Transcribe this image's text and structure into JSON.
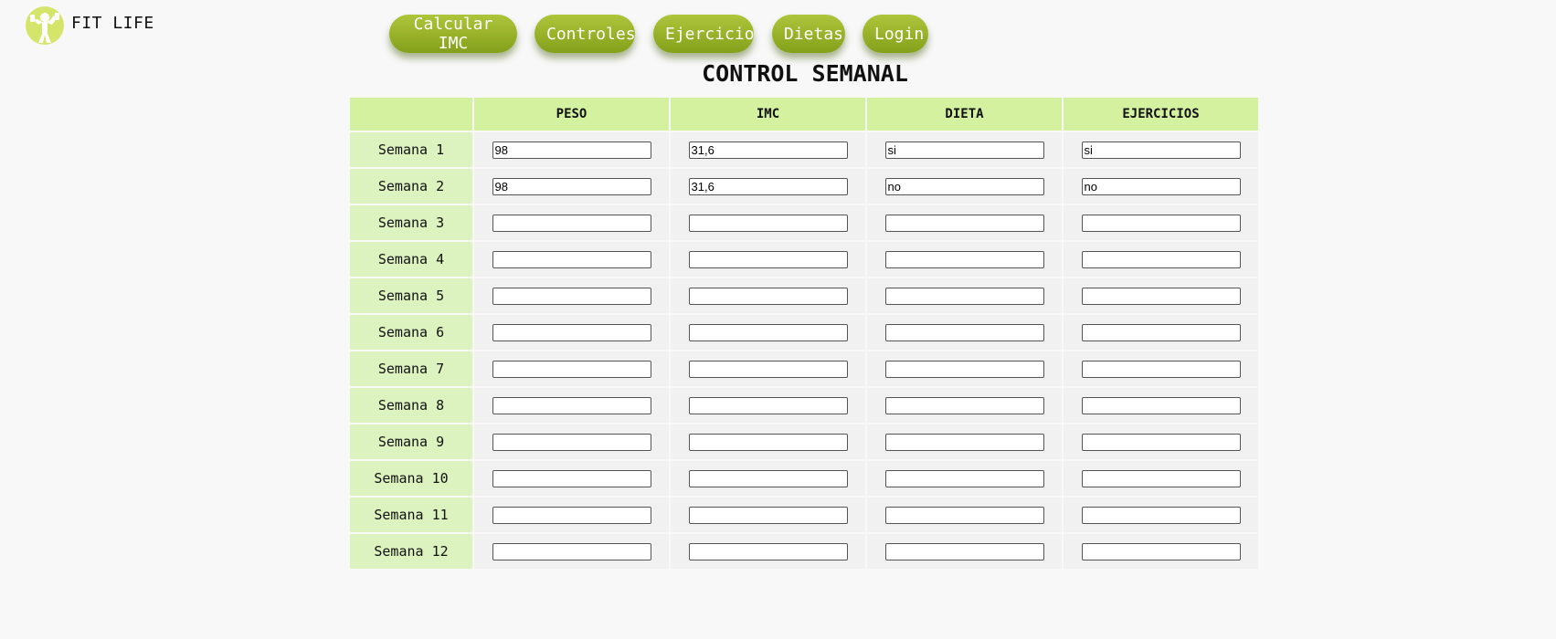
{
  "brand": {
    "name": "FIT LIFE",
    "icon": "fitness-person-icon",
    "color": "#d5e56c"
  },
  "nav": {
    "items": [
      "Calcular IMC",
      "Controles",
      "Ejercicio",
      "Dietas",
      "Login"
    ],
    "accent": "#9ab52c"
  },
  "page": {
    "title": "CONTROL SEMANAL"
  },
  "table": {
    "headers": [
      "",
      "PESO",
      "IMC",
      "DIETA",
      "EJERCICIOS"
    ],
    "rows": [
      {
        "label": "Semana 1",
        "values": [
          "98",
          "31,6",
          "si",
          "si"
        ]
      },
      {
        "label": "Semana 2",
        "values": [
          "98",
          "31,6",
          "no",
          "no"
        ]
      },
      {
        "label": "Semana 3",
        "values": [
          "",
          "",
          "",
          ""
        ]
      },
      {
        "label": "Semana 4",
        "values": [
          "",
          "",
          "",
          ""
        ]
      },
      {
        "label": "Semana 5",
        "values": [
          "",
          "",
          "",
          ""
        ]
      },
      {
        "label": "Semana 6",
        "values": [
          "",
          "",
          "",
          ""
        ]
      },
      {
        "label": "Semana 7",
        "values": [
          "",
          "",
          "",
          ""
        ]
      },
      {
        "label": "Semana 8",
        "values": [
          "",
          "",
          "",
          ""
        ]
      },
      {
        "label": "Semana 9",
        "values": [
          "",
          "",
          "",
          ""
        ]
      },
      {
        "label": "Semana 10",
        "values": [
          "",
          "",
          "",
          ""
        ]
      },
      {
        "label": "Semana 11",
        "values": [
          "",
          "",
          "",
          ""
        ]
      },
      {
        "label": "Semana 12",
        "values": [
          "",
          "",
          "",
          ""
        ]
      }
    ]
  }
}
